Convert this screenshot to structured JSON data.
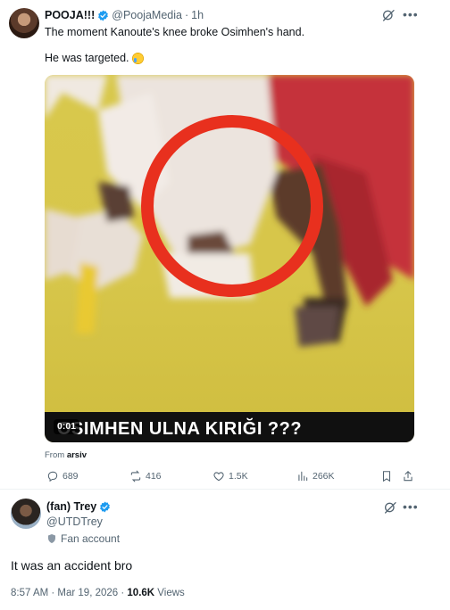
{
  "quoted_post": {
    "author_name": "POOJA!!!",
    "handle": "@PoojaMedia",
    "separator": "·",
    "time": "1h",
    "text_line1": "The moment Kanoute's knee broke Osimhen's hand.",
    "text_line2": "He was targeted.",
    "media": {
      "caption": "OSIMHEN ULNA KIRIĞI ???",
      "duration": "0:01",
      "from_label": "From",
      "from_source": "arsiv"
    },
    "actions": {
      "replies": "689",
      "reposts": "416",
      "likes": "1.5K",
      "views": "266K"
    }
  },
  "main_post": {
    "author_name": "(fan) Trey",
    "handle": "@UTDTrey",
    "label": "Fan account",
    "text": "It was an accident bro",
    "timestamp": "8:57 AM · Mar 19, 2026 · ",
    "view_count": "10.6K",
    "views_label": "Views"
  },
  "colors": {
    "text_primary": "#0f1419",
    "text_secondary": "#536471",
    "verified_blue": "#1d9bf0",
    "ring_red": "#e8301e"
  }
}
